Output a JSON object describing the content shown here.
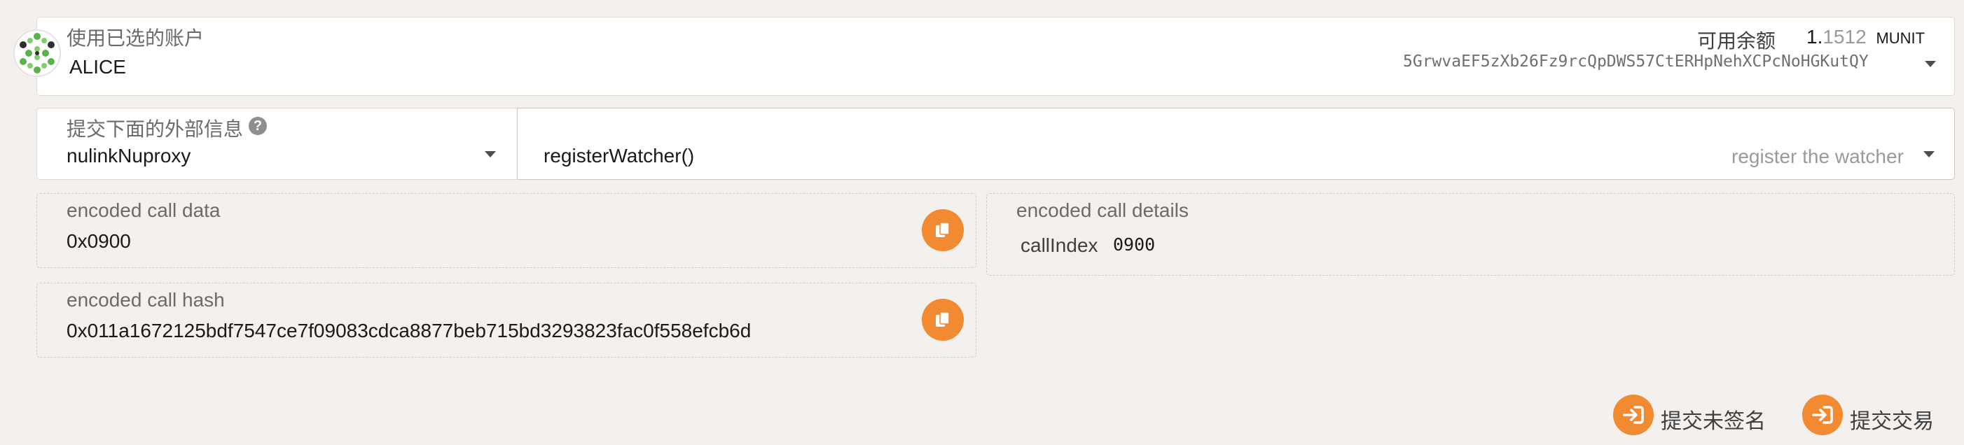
{
  "account": {
    "label": "使用已选的账户",
    "name": "ALICE",
    "balance_label": "可用余额",
    "balance_int": "1.",
    "balance_frac": "1512",
    "balance_unit": "MUNIT",
    "address": "5GrwvaEF5zXb26Fz9rcQpDWS57CtERHpNehXCPcNoHGKutQY"
  },
  "extrinsic": {
    "label": "提交下面的外部信息",
    "help": "?",
    "pallet": "nulinkNuproxy",
    "method": "registerWatcher()",
    "method_desc": "register the watcher"
  },
  "call_data": {
    "label": "encoded call data",
    "value": "0x0900"
  },
  "call_hash": {
    "label": "encoded call hash",
    "value": "0x011a1672125bdf7547ce7f09083cdca8877beb715bd3293823fac0f558efcb6d"
  },
  "call_details": {
    "label": "encoded call details",
    "key": "callIndex",
    "value": "0900"
  },
  "actions": {
    "unsigned": "提交未签名",
    "submit": "提交交易"
  },
  "colors": {
    "accent": "#f18a31",
    "background": "#f3f0ed"
  }
}
